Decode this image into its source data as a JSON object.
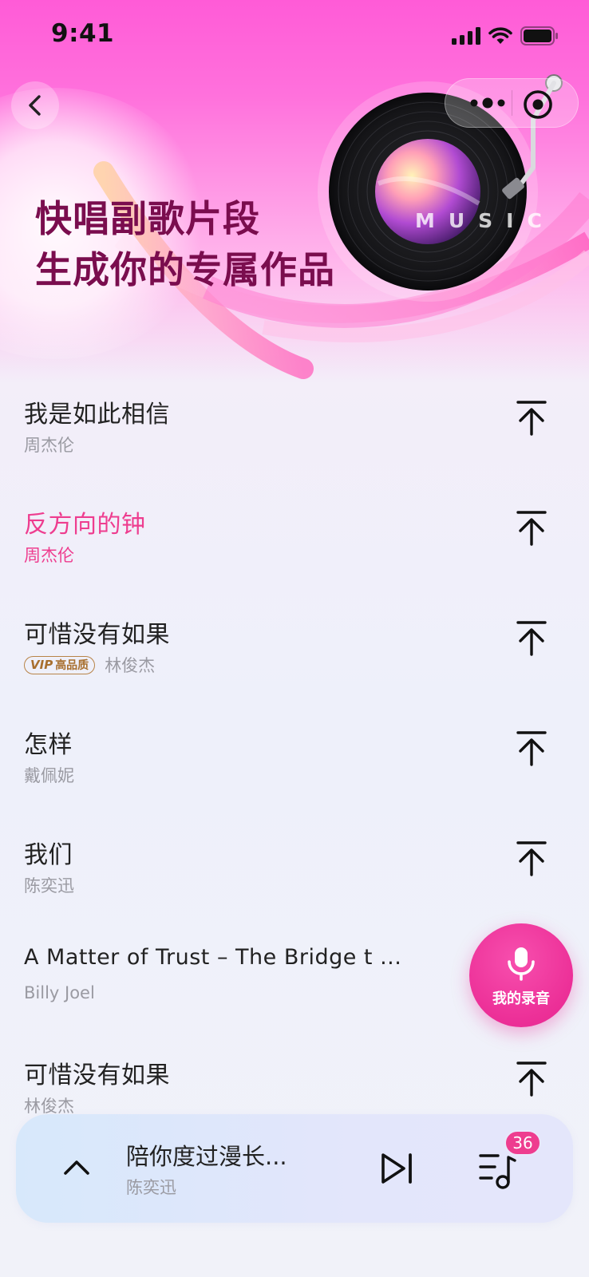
{
  "status_bar": {
    "time": "9:41"
  },
  "hero": {
    "title_line1": "快唱副歌片段",
    "title_line2": "生成你的专属作品",
    "record_word": "MUSIC"
  },
  "songs": [
    {
      "title": "我是如此相信",
      "artist": "周杰伦",
      "active": false,
      "vip": false
    },
    {
      "title": "反方向的钟",
      "artist": "周杰伦",
      "active": true,
      "vip": false
    },
    {
      "title": "可惜没有如果",
      "artist": "林俊杰",
      "active": false,
      "vip": true,
      "vip_mark": "VIP",
      "vip_text": "高品质"
    },
    {
      "title": "怎样",
      "artist": "戴佩妮",
      "active": false,
      "vip": false
    },
    {
      "title": "我们",
      "artist": "陈奕迅",
      "active": false,
      "vip": false
    },
    {
      "title": "A Matter of Trust – The Bridge t ...",
      "artist": "Billy Joel",
      "active": false,
      "vip": false
    },
    {
      "title": "可惜没有如果",
      "artist": "林俊杰",
      "active": false,
      "vip": false
    }
  ],
  "record_button": {
    "label": "我的录音",
    "icon": "microphone-icon"
  },
  "mini_player": {
    "title": "陪你度过漫长...",
    "artist": "陈奕迅",
    "playlist_count": "36"
  },
  "colors": {
    "accent": "#ee3d8f",
    "hero_title": "#7a0d4e",
    "vip": "#b88448",
    "hero_pink": "#ff5bd7"
  }
}
